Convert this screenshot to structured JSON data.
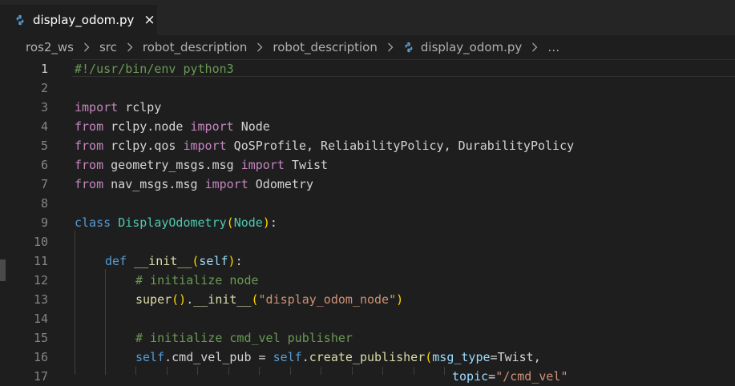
{
  "tab": {
    "label": "display_odom.py",
    "close": "×"
  },
  "breadcrumb": {
    "items": [
      "ros2_ws",
      "src",
      "robot_description",
      "robot_description"
    ],
    "file": "display_odom.py",
    "more": "…"
  },
  "editor": {
    "line_numbers": [
      "1",
      "2",
      "3",
      "4",
      "5",
      "6",
      "7",
      "8",
      "9",
      "10",
      "11",
      "12",
      "13",
      "14",
      "15",
      "16",
      "17"
    ],
    "lines": {
      "l1": {
        "shebang": "#!/usr/bin/env python3"
      },
      "l3": {
        "kw": "import",
        "rest": " rclpy"
      },
      "l4": {
        "kw1": "from",
        "mod": " rclpy.node ",
        "kw2": "import",
        "rest": " Node"
      },
      "l5": {
        "kw1": "from",
        "mod": " rclpy.qos ",
        "kw2": "import",
        "rest": " QoSProfile, ReliabilityPolicy, DurabilityPolicy"
      },
      "l6": {
        "kw1": "from",
        "mod": " geometry_msgs.msg ",
        "kw2": "import",
        "rest": " Twist"
      },
      "l7": {
        "kw1": "from",
        "mod": " nav_msgs.msg ",
        "kw2": "import",
        "rest": " Odometry"
      },
      "l9": {
        "kw": "class",
        "name": "DisplayOdometry",
        "open": "(",
        "base": "Node",
        "close": ")",
        "colon": ":"
      },
      "l11": {
        "kw": "def",
        "name": "__init__",
        "open": "(",
        "param": "self",
        "close": ")",
        "colon": ":"
      },
      "l12": {
        "comment": "# initialize node"
      },
      "l13": {
        "fn": "super",
        "p1": "()",
        "dot": ".",
        "fn2": "__init__",
        "open": "(",
        "str": "\"display_odom_node\"",
        "close": ")"
      },
      "l15": {
        "comment": "# initialize cmd_vel publisher"
      },
      "l16": {
        "self1": "self",
        "attr": ".cmd_vel_pub = ",
        "self2": "self",
        "dot": ".",
        "fn": "create_publisher",
        "open": "(",
        "param": "msg_type",
        "eq": "=",
        "val": "Twist,"
      },
      "l17": {
        "param": "topic",
        "eq": "=",
        "str": "\"/cmd_vel\""
      }
    }
  }
}
